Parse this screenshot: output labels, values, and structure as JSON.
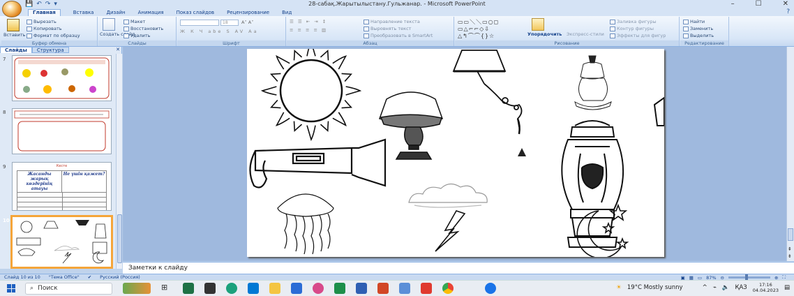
{
  "window": {
    "title": "28-сабақ.Жарытылыстану.Гульжанар. - Microsoft PowerPoint",
    "controls": [
      "–",
      "☐",
      "✕"
    ]
  },
  "ribbon_tabs": [
    "Главная",
    "Вставка",
    "Дизайн",
    "Анимация",
    "Показ слайдов",
    "Рецензирование",
    "Вид"
  ],
  "ribbon": {
    "clipboard": {
      "paste": "Вставить",
      "cut": "Вырезать",
      "copy": "Копировать",
      "format": "Формат по образцу",
      "label": "Буфер обмена"
    },
    "slides": {
      "create": "Создать слайд",
      "layout": "Макет",
      "reset": "Восстановить",
      "delete": "Удалить",
      "label": "Слайды"
    },
    "font": {
      "size": "18",
      "label": "Шрифт"
    },
    "paragraph": {
      "direction": "Направление текста",
      "align": "Выровнять текст",
      "smartart": "Преобразовать в SmartArt",
      "label": "Абзац"
    },
    "drawing": {
      "arrange": "Упорядочить",
      "quickstyles": "Экспресс-стили",
      "fill": "Заливка фигуры",
      "outline": "Контур фигуры",
      "effects": "Эффекты для фигур",
      "label": "Рисование"
    },
    "editing": {
      "find": "Найти",
      "replace": "Заменить",
      "select": "Выделить",
      "label": "Редактирование"
    }
  },
  "left_pane": {
    "tabs": [
      "Слайды",
      "Структура"
    ],
    "slides": [
      {
        "num": "7"
      },
      {
        "num": "8"
      },
      {
        "num": "9",
        "heading": "Кесте",
        "col1": "Жасанды жарық көздерінің атауы",
        "col2": "Не үшін қажет?"
      },
      {
        "num": "10"
      }
    ]
  },
  "notes_placeholder": "Заметки к слайду",
  "status": {
    "slide": "Слайд 10 из 10",
    "theme": "\"Тема Office\"",
    "lang": "Русский (Россия)",
    "zoom": "87%"
  },
  "taskbar": {
    "search": "Поиск",
    "weather": "19°C  Mostly sunny",
    "lang": "ҚАЗ",
    "time": "17:16",
    "date": "04.04.2023"
  }
}
